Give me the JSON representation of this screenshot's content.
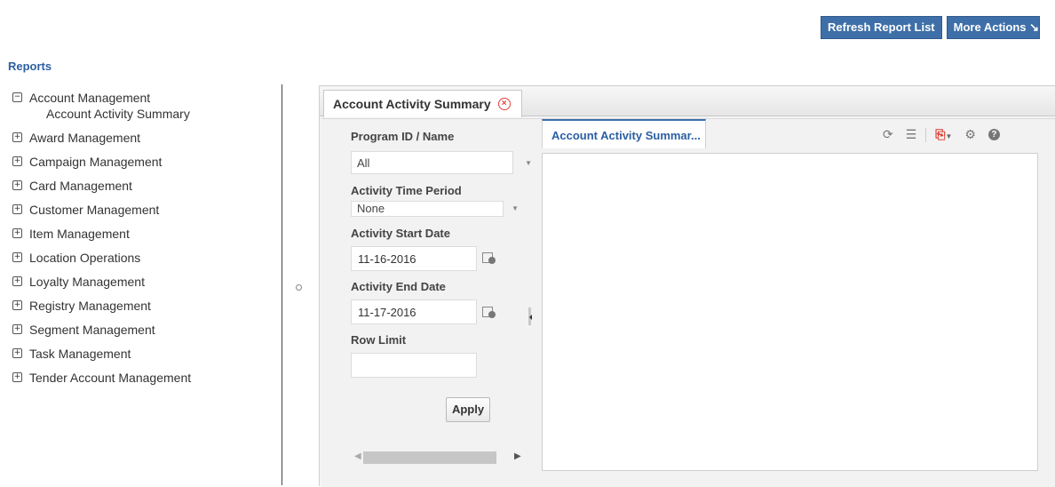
{
  "top_actions": {
    "refresh_label": "Refresh Report List",
    "more_actions_label": "More Actions",
    "more_actions_icon": "arrow-down-right-icon"
  },
  "sidebar": {
    "title": "Reports",
    "items": [
      {
        "label": "Account Management",
        "expanded": true,
        "children": [
          "Account Activity Summary"
        ]
      },
      {
        "label": "Award Management",
        "expanded": false
      },
      {
        "label": "Campaign Management",
        "expanded": false
      },
      {
        "label": "Card Management",
        "expanded": false
      },
      {
        "label": "Customer Management",
        "expanded": false
      },
      {
        "label": "Item Management",
        "expanded": false
      },
      {
        "label": "Location Operations",
        "expanded": false
      },
      {
        "label": "Loyalty Management",
        "expanded": false
      },
      {
        "label": "Registry Management",
        "expanded": false
      },
      {
        "label": "Segment Management",
        "expanded": false
      },
      {
        "label": "Task Management",
        "expanded": false
      },
      {
        "label": "Tender Account Management",
        "expanded": false
      }
    ]
  },
  "main_tab": {
    "label": "Account Activity Summary"
  },
  "params": {
    "program_label": "Program ID / Name",
    "program_value": "All",
    "period_label": "Activity Time Period",
    "period_value": "None",
    "start_label": "Activity Start Date",
    "start_value": "11-16-2016",
    "end_label": "Activity End Date",
    "end_value": "11-17-2016",
    "row_limit_label": "Row Limit",
    "row_limit_value": "",
    "apply_label": "Apply"
  },
  "report": {
    "tab_label": "Account Activity Summar...",
    "toolbar_icons": [
      "refresh-icon",
      "list-icon",
      "pdf-export-icon",
      "settings-icon",
      "help-icon"
    ]
  },
  "colors": {
    "accent": "#3e6fa8",
    "link": "#2b5fa3",
    "close": "#e0403a"
  }
}
